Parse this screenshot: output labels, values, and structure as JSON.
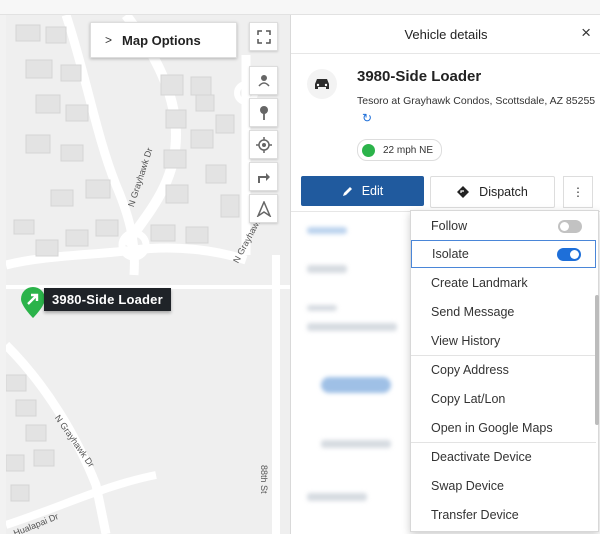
{
  "map": {
    "options_label": "Map Options",
    "streets": {
      "grayhawk_1": "N Grayhawk Dr",
      "grayhawk_2": "N Grayhawk Dr",
      "grayhawk_3": "N Grayhawk Dr",
      "hualapai": "Hualapai Dr",
      "eighty_eighth": "88th St"
    },
    "tools": [
      "expand-icon",
      "person-pin-icon",
      "pin-icon",
      "locate-icon",
      "directions-icon",
      "navigation-icon"
    ],
    "vehicle_label": "3980-Side Loader"
  },
  "panel": {
    "title": "Vehicle details",
    "close_icon": "×",
    "vehicle_name": "3980-Side Loader",
    "address": "Tesoro at Grayhawk Condos, Scottsdale, AZ 85255",
    "speed": "22 mph NE",
    "status_color": "#2bb34a",
    "edit_label": "Edit",
    "dispatch_label": "Dispatch",
    "more_label": "⋮"
  },
  "menu": {
    "items": [
      {
        "label": "Follow",
        "toggle": false
      },
      {
        "label": "Isolate",
        "toggle": true
      },
      {
        "label": "Create Landmark"
      },
      {
        "label": "Send Message"
      },
      {
        "label": "View History"
      },
      {
        "label": "Copy Address"
      },
      {
        "label": "Copy Lat/Lon"
      },
      {
        "label": "Open in Google Maps"
      },
      {
        "label": "Deactivate Device"
      },
      {
        "label": "Swap Device"
      },
      {
        "label": "Transfer Device"
      }
    ]
  },
  "colors": {
    "accent": "#205a9e",
    "toggle_on": "#1e6fd9",
    "marker": "#2bb34a"
  }
}
